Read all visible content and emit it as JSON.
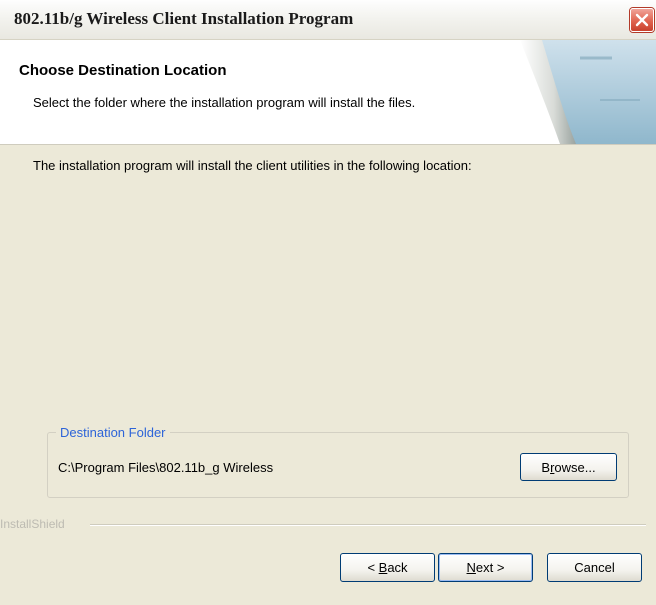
{
  "window": {
    "title": "802.11b/g Wireless Client Installation Program"
  },
  "header": {
    "title": "Choose Destination Location",
    "subtitle": "Select the folder where the installation program will install the files."
  },
  "body": {
    "message": "The installation program will install the client utilities in the following location:"
  },
  "destination": {
    "legend": "Destination Folder",
    "path": "C:\\Program Files\\802.11b_g Wireless",
    "browse_label_pre": "B",
    "browse_label_key": "r",
    "browse_label_post": "owse..."
  },
  "footer": {
    "brand": "InstallShield",
    "back_pre": "< ",
    "back_key": "B",
    "back_post": "ack",
    "next_key": "N",
    "next_post": "ext >",
    "cancel_label": "Cancel"
  },
  "icons": {
    "close": "close-icon",
    "header_art": "page-curl-graphic"
  },
  "colors": {
    "dialog_bg": "#ece9d8",
    "close_red": "#e06450",
    "legend_blue": "#2d64d8"
  }
}
